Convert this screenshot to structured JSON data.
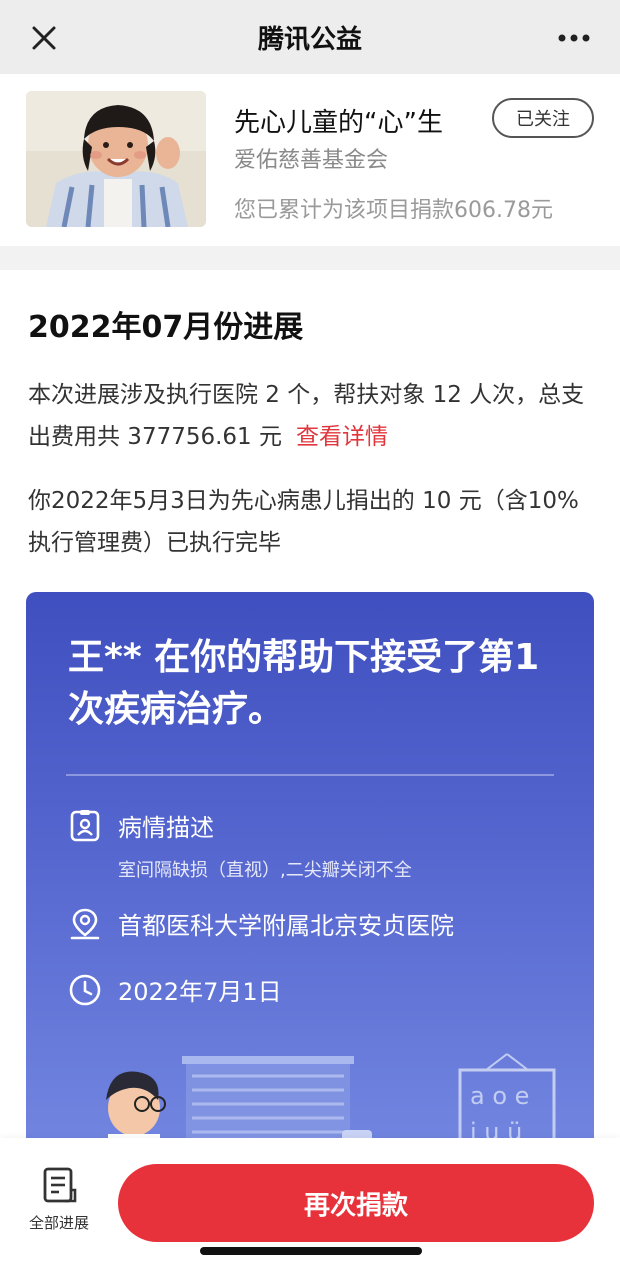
{
  "nav": {
    "title": "腾讯公益",
    "close_icon": "close-icon",
    "more_icon": "more-icon"
  },
  "project": {
    "title": "先心儿童的“心”生",
    "org": "爱佑慈善基金会",
    "donated": "您已累计为该项目捐款606.78元",
    "follow_label": "已关注"
  },
  "progress": {
    "title": "2022年07月份进展",
    "summary": "本次进展涉及执行医院 2 个，帮扶对象 12 人次，总支出费用共 377756.61 元",
    "detail_link": "查看详情",
    "donation_note": "你2022年5月3日为先心病患儿捐出的 10 元（含10%执行管理费）已执行完毕"
  },
  "card": {
    "headline": "王** 在你的帮助下接受了第1 次疾病治疗。",
    "condition_label": "病情描述",
    "condition_detail": "室间隔缺损（直视）,二尖瓣关闭不全",
    "hospital": "首都医科大学附属北京安贞医院",
    "date": "2022年7月1日",
    "colors": {
      "top": "#3f4fbf",
      "bottom": "#7286e0"
    }
  },
  "bottom": {
    "all_progress_label": "全部进展",
    "donate_again_label": "再次捐款",
    "accent": "#e8323b"
  }
}
